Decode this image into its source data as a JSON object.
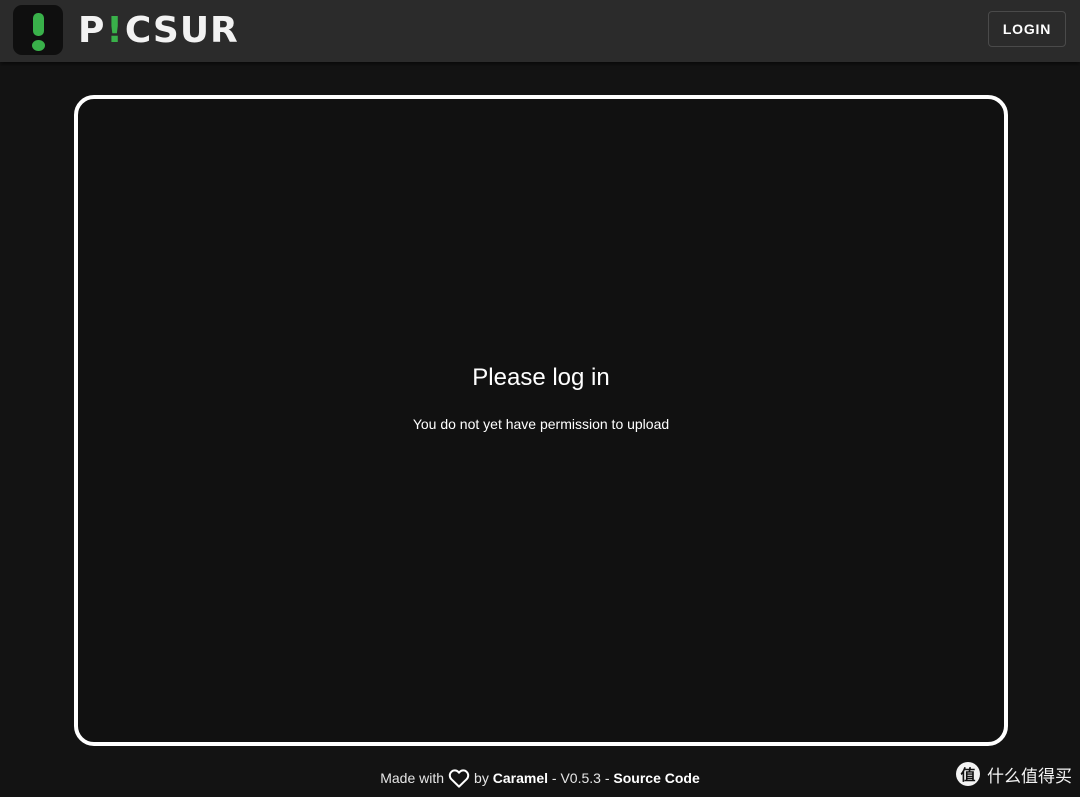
{
  "header": {
    "logo_text_start": "P",
    "logo_text_excl": "!",
    "logo_text_end": "CSUR",
    "login_label": "LOGIN"
  },
  "main": {
    "title": "Please log in",
    "subtitle": "You do not yet have permission to upload"
  },
  "footer": {
    "made_with": "Made with",
    "by": "by",
    "author": "Caramel",
    "sep1": " - ",
    "version": "V0.5.3",
    "sep2": " - ",
    "source_link": "Source Code"
  },
  "watermark": {
    "badge": "值",
    "text": "什么值得买"
  },
  "colors": {
    "accent_green": "#39b14a",
    "header_bg": "#2b2b2b",
    "page_bg": "#131313",
    "card_border": "#ffffff"
  },
  "icons": {
    "logo": "green-exclamation-logo-icon",
    "heart": "heart-outline-icon"
  }
}
